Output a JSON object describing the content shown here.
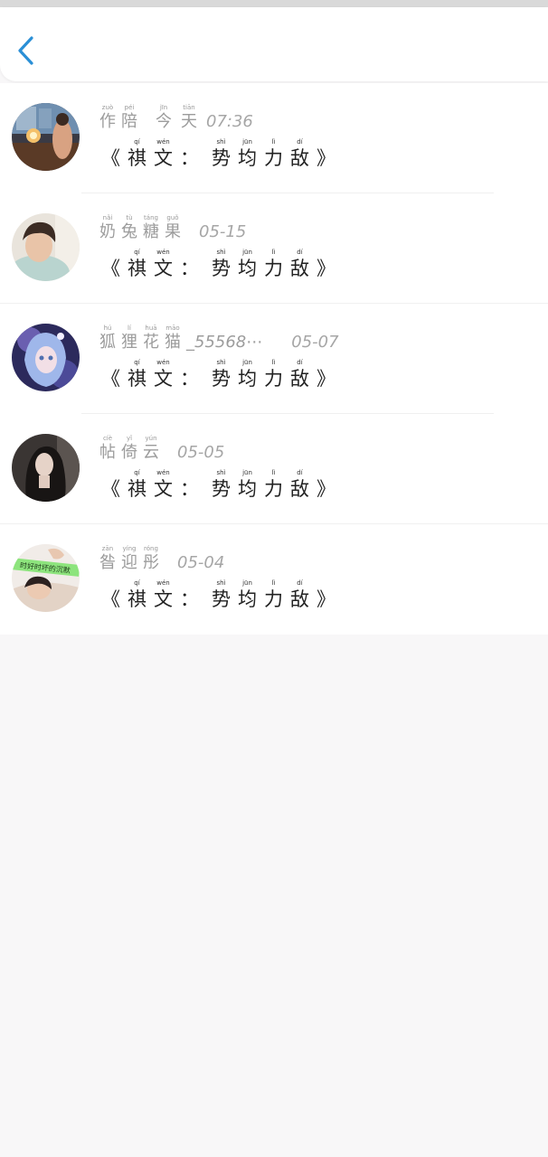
{
  "header": {
    "back_label": "‹"
  },
  "messages": [
    {
      "name": [
        [
          "zuò",
          "作"
        ],
        [
          "péi",
          "陪"
        ]
      ],
      "name_tail": "",
      "time_ruby": [
        [
          "jīn",
          "今"
        ],
        [
          "tiān",
          "天"
        ]
      ],
      "time": "07:36",
      "message": [
        [
          "",
          "《"
        ],
        [
          "qí",
          "祺"
        ],
        [
          "wén",
          "文"
        ],
        [
          "",
          "："
        ],
        [
          "shì",
          "势"
        ],
        [
          "jūn",
          "均"
        ],
        [
          "lì",
          "力"
        ],
        [
          "dí",
          "敌"
        ],
        [
          "",
          "》"
        ]
      ]
    },
    {
      "name": [
        [
          "nǎi",
          "奶"
        ],
        [
          "tù",
          "兔"
        ],
        [
          "táng",
          "糖"
        ],
        [
          "guǒ",
          "果"
        ]
      ],
      "name_tail": "",
      "time_ruby": [],
      "time": "05-15",
      "message": [
        [
          "",
          "《"
        ],
        [
          "qí",
          "祺"
        ],
        [
          "wén",
          "文"
        ],
        [
          "",
          "："
        ],
        [
          "shì",
          "势"
        ],
        [
          "jūn",
          "均"
        ],
        [
          "lì",
          "力"
        ],
        [
          "dí",
          "敌"
        ],
        [
          "",
          "》"
        ]
      ]
    },
    {
      "name": [
        [
          "hú",
          "狐"
        ],
        [
          "lí",
          "狸"
        ],
        [
          "huā",
          "花"
        ],
        [
          "māo",
          "猫"
        ]
      ],
      "name_tail": "_55568⋯",
      "time_ruby": [],
      "time": "05-07",
      "message": [
        [
          "",
          "《"
        ],
        [
          "qí",
          "祺"
        ],
        [
          "wén",
          "文"
        ],
        [
          "",
          "："
        ],
        [
          "shì",
          "势"
        ],
        [
          "jūn",
          "均"
        ],
        [
          "lì",
          "力"
        ],
        [
          "dí",
          "敌"
        ],
        [
          "",
          "》"
        ]
      ]
    },
    {
      "name": [
        [
          "cíè",
          "帖"
        ],
        [
          "yǐ",
          "倚"
        ],
        [
          "yún",
          "云"
        ]
      ],
      "name_tail": "",
      "time_ruby": [],
      "time": "05-05",
      "message": [
        [
          "",
          "《"
        ],
        [
          "qí",
          "祺"
        ],
        [
          "wén",
          "文"
        ],
        [
          "",
          "："
        ],
        [
          "shì",
          "势"
        ],
        [
          "jūn",
          "均"
        ],
        [
          "lì",
          "力"
        ],
        [
          "dí",
          "敌"
        ],
        [
          "",
          "》"
        ]
      ]
    },
    {
      "name": [
        [
          "zān",
          "昝"
        ],
        [
          "yíng",
          "迎"
        ],
        [
          "róng",
          "彤"
        ]
      ],
      "name_tail": "",
      "time_ruby": [],
      "time": "05-04",
      "message": [
        [
          "",
          "《"
        ],
        [
          "qí",
          "祺"
        ],
        [
          "wén",
          "文"
        ],
        [
          "",
          "："
        ],
        [
          "shì",
          "势"
        ],
        [
          "jūn",
          "均"
        ],
        [
          "lì",
          "力"
        ],
        [
          "dí",
          "敌"
        ],
        [
          "",
          "》"
        ]
      ]
    }
  ],
  "avatar5_sticker": "时好时坏的沉默",
  "colors": {
    "accent": "#2a8fd6",
    "name": "#9c9c9c",
    "message": "#222222"
  }
}
